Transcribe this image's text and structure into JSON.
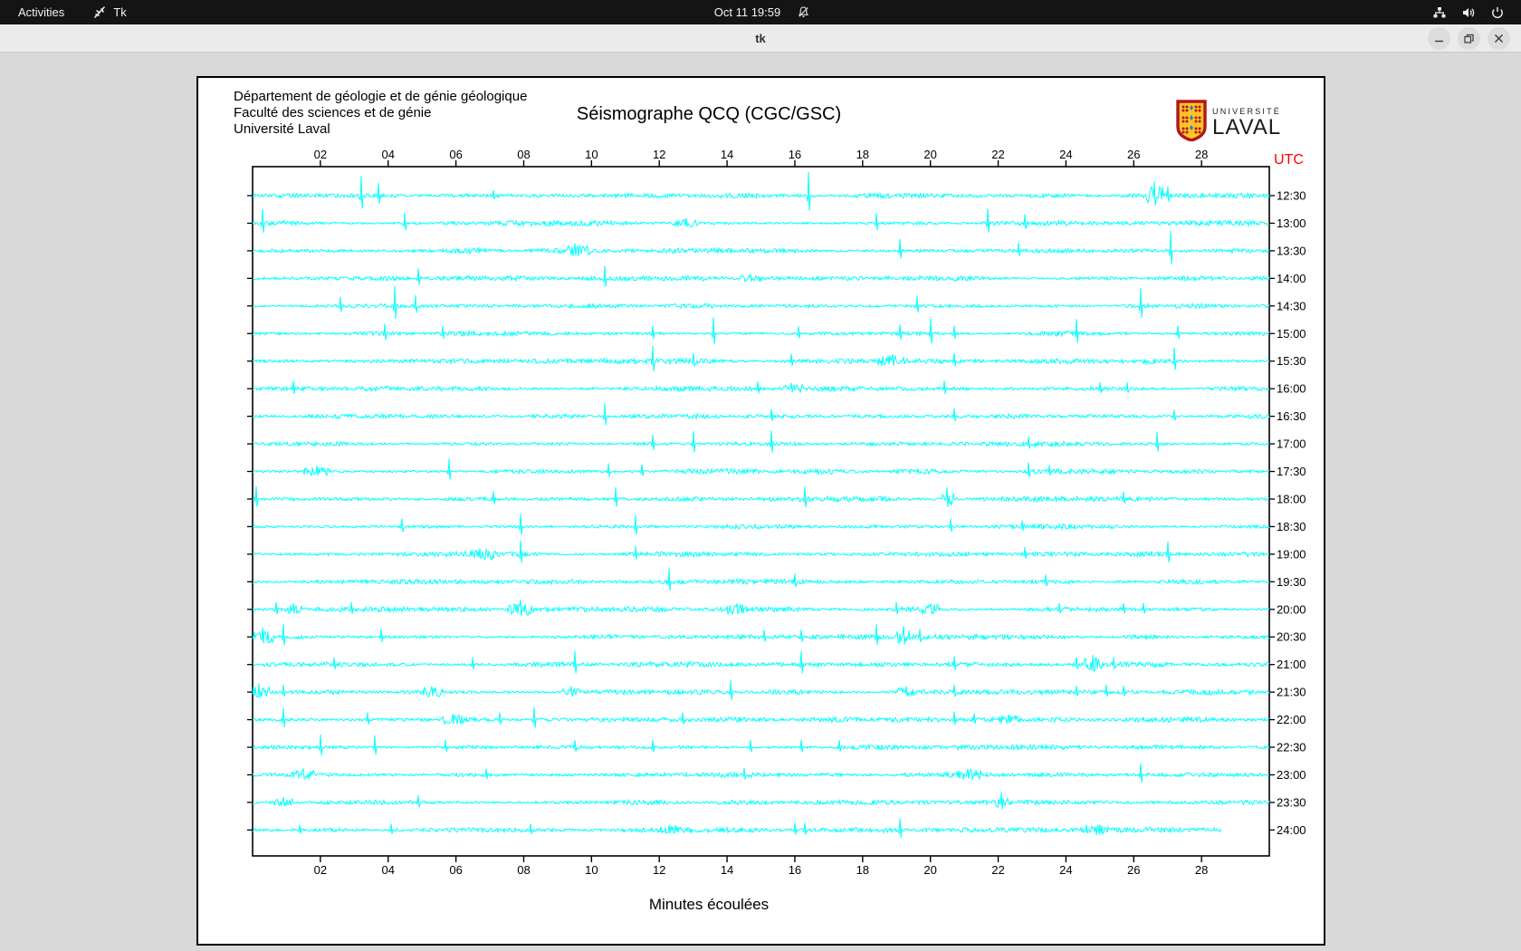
{
  "topbar": {
    "activities_label": "Activities",
    "app_indicator_label": "Tk",
    "clock": "Oct 11 19:59",
    "icons": [
      "tk-icon",
      "bell-muted-icon",
      "network-icon",
      "volume-icon",
      "power-icon"
    ]
  },
  "titlebar": {
    "title": "tk",
    "buttons": [
      "minimize",
      "restore",
      "close"
    ]
  },
  "seismograph": {
    "header_lines": [
      "Département de géologie et de génie géologique",
      "Faculté des sciences et de génie",
      "Université Laval"
    ],
    "title": "Séismographe QCQ (CGC/GSC)",
    "utc_label": "UTC",
    "xlabel": "Minutes écoulées",
    "logo": {
      "line1": "UNIVERSITÉ",
      "line2": "LAVAL"
    },
    "colors": {
      "trace": "#00ffff",
      "utc": "#ff0000",
      "axis": "#000000",
      "shield_red": "#b0161d",
      "shield_gold": "#ffc425",
      "shield_blue": "#1f7fd4"
    },
    "chart_data": {
      "type": "line",
      "x_range": [
        0,
        30
      ],
      "x_ticks": [
        "02",
        "04",
        "06",
        "08",
        "10",
        "12",
        "14",
        "16",
        "18",
        "20",
        "22",
        "24",
        "26",
        "28"
      ],
      "rows": [
        {
          "label": "12:30",
          "end_minute": 30,
          "spikes": [
            {
              "m": 3.2,
              "a": 22
            },
            {
              "m": 3.7,
              "a": 14
            },
            {
              "m": 7.1,
              "a": 6
            },
            {
              "m": 16.4,
              "a": 26
            },
            {
              "m": 26.6,
              "a": 20,
              "w": 0.5
            },
            {
              "m": 27.0,
              "a": 10
            }
          ]
        },
        {
          "label": "13:00",
          "end_minute": 30,
          "spikes": [
            {
              "m": 0.3,
              "a": 16
            },
            {
              "m": 4.5,
              "a": 12
            },
            {
              "m": 12.8,
              "a": 7,
              "w": 0.8
            },
            {
              "m": 18.4,
              "a": 12
            },
            {
              "m": 21.7,
              "a": 16
            },
            {
              "m": 22.8,
              "a": 10
            }
          ]
        },
        {
          "label": "13:30",
          "end_minute": 30,
          "spikes": [
            {
              "m": 9.5,
              "a": 10,
              "w": 0.9
            },
            {
              "m": 19.1,
              "a": 13
            },
            {
              "m": 22.6,
              "a": 9
            },
            {
              "m": 27.1,
              "a": 22
            }
          ]
        },
        {
          "label": "14:00",
          "end_minute": 30,
          "spikes": [
            {
              "m": 4.9,
              "a": 11
            },
            {
              "m": 10.4,
              "a": 14
            },
            {
              "m": 14.7,
              "a": 6,
              "w": 0.8
            }
          ]
        },
        {
          "label": "14:30",
          "end_minute": 30,
          "spikes": [
            {
              "m": 2.6,
              "a": 10
            },
            {
              "m": 4.2,
              "a": 22
            },
            {
              "m": 4.8,
              "a": 12
            },
            {
              "m": 19.6,
              "a": 11
            },
            {
              "m": 26.2,
              "a": 20
            }
          ]
        },
        {
          "label": "15:00",
          "end_minute": 30,
          "spikes": [
            {
              "m": 3.9,
              "a": 11
            },
            {
              "m": 5.6,
              "a": 9
            },
            {
              "m": 11.8,
              "a": 9
            },
            {
              "m": 13.6,
              "a": 18
            },
            {
              "m": 16.1,
              "a": 8
            },
            {
              "m": 19.1,
              "a": 10
            },
            {
              "m": 20.0,
              "a": 17
            },
            {
              "m": 20.7,
              "a": 9
            },
            {
              "m": 24.3,
              "a": 16
            },
            {
              "m": 27.3,
              "a": 9
            }
          ]
        },
        {
          "label": "15:30",
          "end_minute": 30,
          "spikes": [
            {
              "m": 11.8,
              "a": 17
            },
            {
              "m": 13.0,
              "a": 9
            },
            {
              "m": 15.9,
              "a": 8
            },
            {
              "m": 18.9,
              "a": 9,
              "w": 0.9
            },
            {
              "m": 20.7,
              "a": 9
            },
            {
              "m": 27.2,
              "a": 15
            }
          ]
        },
        {
          "label": "16:00",
          "end_minute": 30,
          "spikes": [
            {
              "m": 1.2,
              "a": 9
            },
            {
              "m": 14.9,
              "a": 8
            },
            {
              "m": 15.9,
              "a": 8,
              "w": 0.7
            },
            {
              "m": 20.4,
              "a": 9
            },
            {
              "m": 25.0,
              "a": 7
            },
            {
              "m": 25.8,
              "a": 7
            }
          ]
        },
        {
          "label": "16:30",
          "end_minute": 30,
          "spikes": [
            {
              "m": 10.4,
              "a": 15
            },
            {
              "m": 15.3,
              "a": 8
            },
            {
              "m": 20.7,
              "a": 9
            },
            {
              "m": 27.2,
              "a": 7
            }
          ]
        },
        {
          "label": "17:00",
          "end_minute": 30,
          "spikes": [
            {
              "m": 11.8,
              "a": 10
            },
            {
              "m": 13.0,
              "a": 14
            },
            {
              "m": 15.3,
              "a": 15
            },
            {
              "m": 22.9,
              "a": 8
            },
            {
              "m": 26.7,
              "a": 13
            }
          ]
        },
        {
          "label": "17:30",
          "end_minute": 30,
          "spikes": [
            {
              "m": 1.9,
              "a": 8,
              "w": 0.8
            },
            {
              "m": 5.8,
              "a": 14
            },
            {
              "m": 10.5,
              "a": 9
            },
            {
              "m": 11.5,
              "a": 8
            },
            {
              "m": 22.9,
              "a": 10
            },
            {
              "m": 23.5,
              "a": 7
            }
          ]
        },
        {
          "label": "18:00",
          "end_minute": 30,
          "spikes": [
            {
              "m": 0.1,
              "a": 14
            },
            {
              "m": 7.1,
              "a": 9
            },
            {
              "m": 10.7,
              "a": 13
            },
            {
              "m": 16.3,
              "a": 14
            },
            {
              "m": 20.5,
              "a": 16,
              "w": 0.4
            },
            {
              "m": 25.7,
              "a": 8
            }
          ]
        },
        {
          "label": "18:30",
          "end_minute": 30,
          "spikes": [
            {
              "m": 4.4,
              "a": 9
            },
            {
              "m": 7.9,
              "a": 14
            },
            {
              "m": 11.3,
              "a": 13
            },
            {
              "m": 20.6,
              "a": 9
            },
            {
              "m": 22.7,
              "a": 7
            }
          ]
        },
        {
          "label": "19:00",
          "end_minute": 30,
          "spikes": [
            {
              "m": 6.7,
              "a": 8,
              "w": 0.9
            },
            {
              "m": 7.9,
              "a": 15
            },
            {
              "m": 11.3,
              "a": 9
            },
            {
              "m": 22.8,
              "a": 8
            },
            {
              "m": 27.0,
              "a": 14
            }
          ]
        },
        {
          "label": "19:30",
          "end_minute": 30,
          "spikes": [
            {
              "m": 12.3,
              "a": 15
            },
            {
              "m": 16.0,
              "a": 9
            },
            {
              "m": 23.4,
              "a": 8
            }
          ]
        },
        {
          "label": "20:00",
          "end_minute": 30,
          "spikes": [
            {
              "m": 0.7,
              "a": 8
            },
            {
              "m": 1.2,
              "a": 8,
              "w": 0.5
            },
            {
              "m": 2.9,
              "a": 8
            },
            {
              "m": 7.9,
              "a": 13,
              "w": 0.8
            },
            {
              "m": 14.3,
              "a": 8,
              "w": 0.6
            },
            {
              "m": 19.0,
              "a": 8
            },
            {
              "m": 20.0,
              "a": 8,
              "w": 0.5
            },
            {
              "m": 23.8,
              "a": 7
            },
            {
              "m": 25.7,
              "a": 7
            },
            {
              "m": 26.3,
              "a": 7
            }
          ]
        },
        {
          "label": "20:30",
          "end_minute": 30,
          "spikes": [
            {
              "m": 0.3,
              "a": 13,
              "w": 0.7
            },
            {
              "m": 0.9,
              "a": 14
            },
            {
              "m": 3.8,
              "a": 9
            },
            {
              "m": 15.1,
              "a": 8
            },
            {
              "m": 16.2,
              "a": 8
            },
            {
              "m": 18.4,
              "a": 14
            },
            {
              "m": 19.2,
              "a": 15,
              "w": 0.4
            },
            {
              "m": 19.7,
              "a": 9
            }
          ]
        },
        {
          "label": "21:00",
          "end_minute": 30,
          "spikes": [
            {
              "m": 2.4,
              "a": 8
            },
            {
              "m": 6.5,
              "a": 8
            },
            {
              "m": 9.5,
              "a": 15
            },
            {
              "m": 16.2,
              "a": 15
            },
            {
              "m": 20.7,
              "a": 9
            },
            {
              "m": 24.3,
              "a": 8
            },
            {
              "m": 24.8,
              "a": 13,
              "w": 0.5
            },
            {
              "m": 25.4,
              "a": 8
            }
          ]
        },
        {
          "label": "21:30",
          "end_minute": 30,
          "spikes": [
            {
              "m": 0.2,
              "a": 12,
              "w": 0.6
            },
            {
              "m": 0.9,
              "a": 8
            },
            {
              "m": 5.3,
              "a": 8,
              "w": 0.6
            },
            {
              "m": 9.4,
              "a": 8,
              "w": 0.5
            },
            {
              "m": 14.1,
              "a": 13
            },
            {
              "m": 19.3,
              "a": 8,
              "w": 0.5
            },
            {
              "m": 20.7,
              "a": 8
            },
            {
              "m": 24.3,
              "a": 7
            },
            {
              "m": 25.2,
              "a": 8
            },
            {
              "m": 25.7,
              "a": 7
            }
          ]
        },
        {
          "label": "22:00",
          "end_minute": 30,
          "spikes": [
            {
              "m": 0.9,
              "a": 13
            },
            {
              "m": 3.4,
              "a": 8
            },
            {
              "m": 5.9,
              "a": 8,
              "w": 0.6
            },
            {
              "m": 7.3,
              "a": 8
            },
            {
              "m": 8.3,
              "a": 14
            },
            {
              "m": 12.7,
              "a": 8
            },
            {
              "m": 20.7,
              "a": 9
            },
            {
              "m": 21.3,
              "a": 7
            },
            {
              "m": 22.3,
              "a": 7,
              "w": 0.6
            }
          ]
        },
        {
          "label": "22:30",
          "end_minute": 30,
          "spikes": [
            {
              "m": 2.0,
              "a": 14
            },
            {
              "m": 3.6,
              "a": 13
            },
            {
              "m": 5.7,
              "a": 8
            },
            {
              "m": 9.5,
              "a": 8
            },
            {
              "m": 11.8,
              "a": 8
            },
            {
              "m": 14.7,
              "a": 8
            },
            {
              "m": 16.2,
              "a": 8
            },
            {
              "m": 17.3,
              "a": 8
            }
          ]
        },
        {
          "label": "23:00",
          "end_minute": 30,
          "spikes": [
            {
              "m": 1.5,
              "a": 8,
              "w": 0.7
            },
            {
              "m": 6.9,
              "a": 7
            },
            {
              "m": 14.5,
              "a": 8
            },
            {
              "m": 21.1,
              "a": 8,
              "w": 0.8
            },
            {
              "m": 26.2,
              "a": 13
            }
          ]
        },
        {
          "label": "23:30",
          "end_minute": 30,
          "spikes": [
            {
              "m": 0.9,
              "a": 7,
              "w": 0.6
            },
            {
              "m": 4.9,
              "a": 8
            },
            {
              "m": 22.1,
              "a": 14,
              "w": 0.4
            }
          ]
        },
        {
          "label": "24:00",
          "end_minute": 28.6,
          "spikes": [
            {
              "m": 1.4,
              "a": 6
            },
            {
              "m": 4.1,
              "a": 7
            },
            {
              "m": 8.2,
              "a": 7
            },
            {
              "m": 12.3,
              "a": 7,
              "w": 0.5
            },
            {
              "m": 16.0,
              "a": 8
            },
            {
              "m": 16.3,
              "a": 8
            },
            {
              "m": 19.1,
              "a": 13
            },
            {
              "m": 24.6,
              "a": 6
            },
            {
              "m": 25.0,
              "a": 7,
              "w": 0.5
            }
          ]
        }
      ]
    }
  }
}
